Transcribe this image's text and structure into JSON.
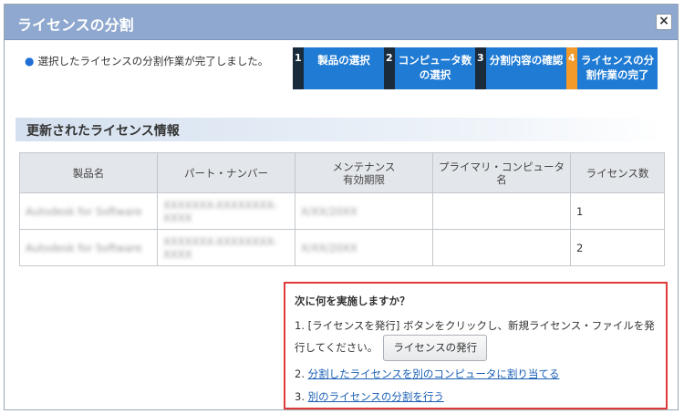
{
  "dialog": {
    "title": "ライセンスの分割",
    "close_glyph": "×"
  },
  "message": "選択したライセンスの分割作業が完了しました。",
  "steps": [
    {
      "num": "1",
      "label1": "製品の選択",
      "label2": ""
    },
    {
      "num": "2",
      "label1": "コンピュータ数",
      "label2": "の選択"
    },
    {
      "num": "3",
      "label1": "分割内容の確認",
      "label2": ""
    },
    {
      "num": "4",
      "label1": "ライセンスの分",
      "label2": "割作業の完了"
    }
  ],
  "section": {
    "title": "更新されたライセンス情報"
  },
  "table": {
    "headers": [
      "製品名",
      "パート・ナンバー",
      "メンテナンス\n有効期限",
      "プライマリ・コンピュータ\n名",
      "ライセンス数"
    ],
    "rows": [
      [
        "Autodesk for Software",
        "XXXXXXX-XXXXXXXX-XXXX",
        "X/XX/20XX",
        "",
        "1"
      ],
      [
        "Autodesk for Software",
        "XXXXXXX-XXXXXXXX-XXXX",
        "X/XX/20XX",
        "",
        "2"
      ]
    ]
  },
  "next": {
    "question": "次に何を実施しますか？",
    "step1_text": "1. [ライセンスを発行] ボタンをクリックし、新規ライセンス・ファイルを発行してください。",
    "issue_button": "ライセンスの発行",
    "step2_prefix": "2. ",
    "step2_link": "分割したライセンスを別のコンピュータに割り当てる",
    "step3_prefix": "3. ",
    "step3_link": "別のライセンスの分割を行う"
  },
  "colors": {
    "accent": "#1f7bd4",
    "title_bar": "#8fa8cf",
    "current_step": "#f39a2b",
    "highlight_border": "#e03a3a"
  }
}
